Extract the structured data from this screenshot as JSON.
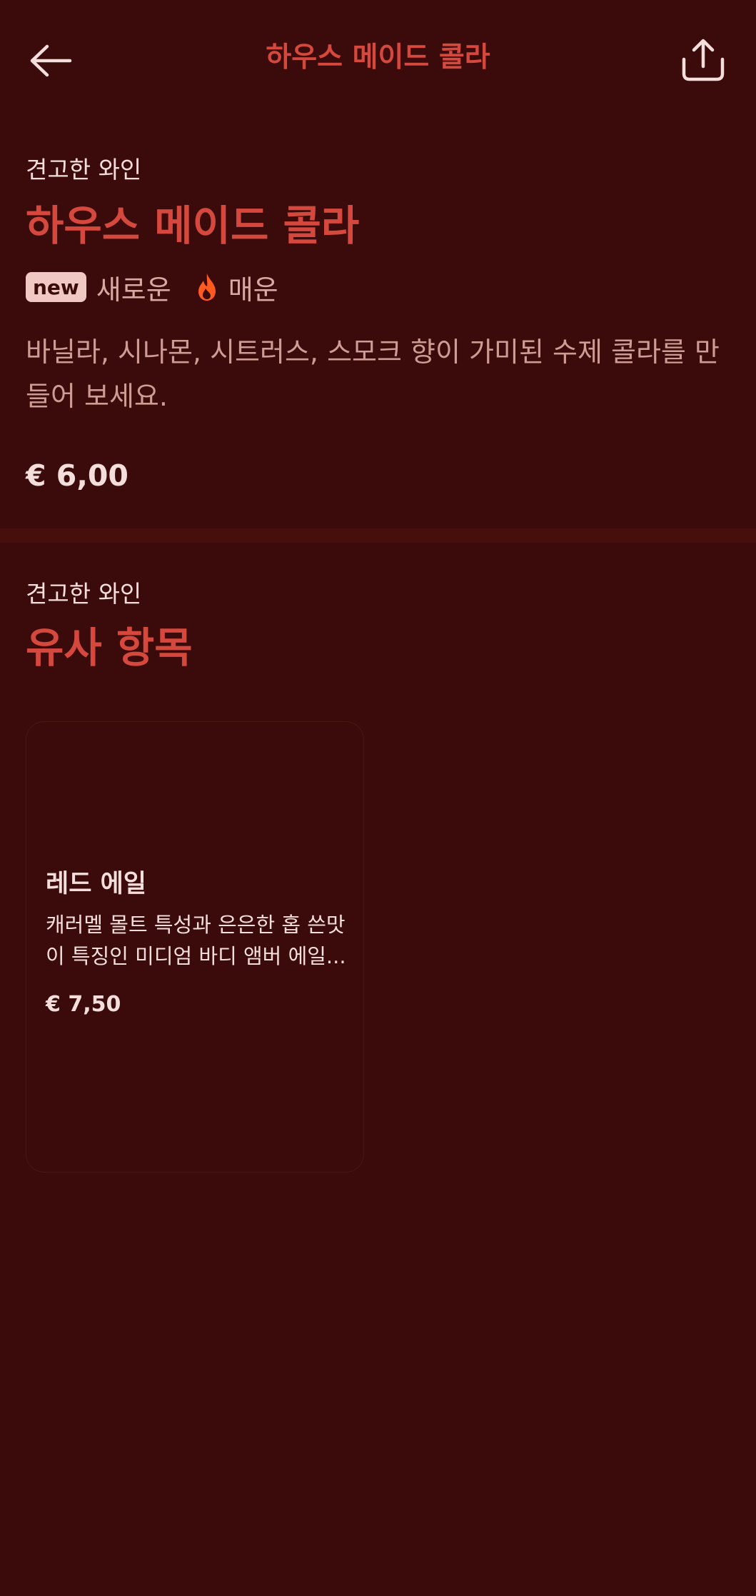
{
  "header": {
    "title": "하우스 메이드 콜라",
    "back_icon": "arrow-left-icon",
    "share_icon": "share-icon"
  },
  "product": {
    "category": "견고한 와인",
    "name": "하우스 메이드 콜라",
    "badge": "new",
    "badge_label": "새로운",
    "spicy_label": "매운",
    "description": "바닐라, 시나몬, 시트러스, 스모크 향이 가미된 수제 콜라를 만들어 보세요.",
    "price": "€ 6,00"
  },
  "similar": {
    "category": "견고한 와인",
    "title": "유사 항목",
    "items": [
      {
        "name": "레드 에일",
        "description": "캐러멜 몰트 특성과 은은한 홉 쓴맛이 특징인 미디엄 바디 앰버 에일...",
        "price": "€ 7,50"
      }
    ]
  },
  "colors": {
    "background": "#3a0b0a",
    "accent": "#d5483d",
    "text": "#f3dedb",
    "flame": "#ff5a1f"
  }
}
